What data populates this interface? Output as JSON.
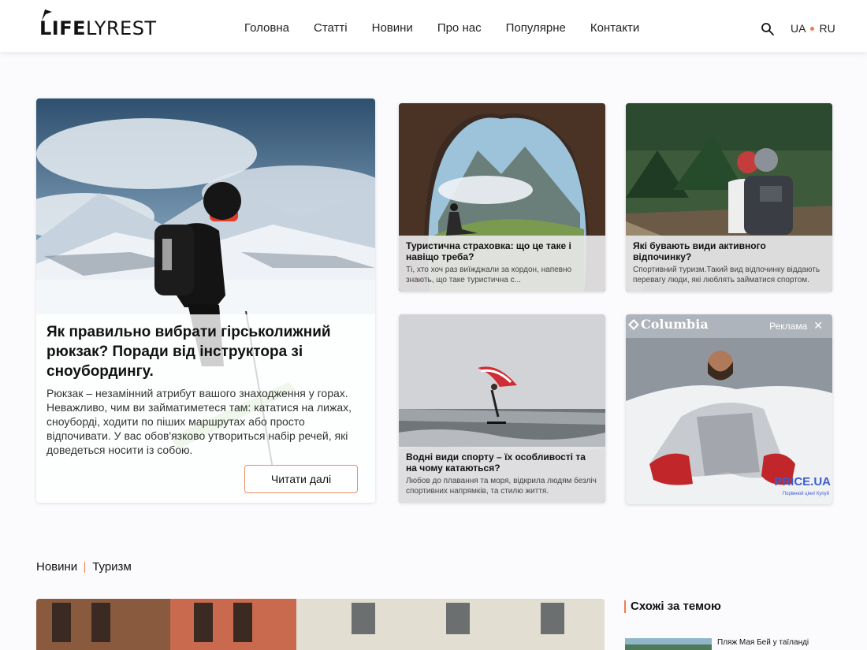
{
  "brand": {
    "logo_bold": "LIFE",
    "logo_light": "LYREST"
  },
  "nav": [
    "Головна",
    "Статті",
    "Новини",
    "Про нас",
    "Популярне",
    "Контакти"
  ],
  "lang": {
    "current": "UA",
    "other": "RU",
    "accent": "#ef7a4b"
  },
  "icons": {
    "search": "search-icon",
    "close": "close-icon"
  },
  "hero": {
    "title": "Як правильно вибрати гірськолижний рюкзак? Поради від інструктора зі сноубордингу.",
    "excerpt": "Рюкзак – незамінний атрибут вашого знаходження у горах. Неважливо, чим ви займатиметеся там: кататися на лижах, сноуборді, ходити по піших маршрутах або просто відпочивати. У вас обов'язково утвориться набір речей, які доведеться носити із собою.",
    "button": "Читати далі"
  },
  "cards": [
    {
      "title": "Туристична страховка: що це таке і навіщо треба?",
      "text": "Ті, хто хоч раз виїжджали за кордон, напевно знають, що таке туристична с..."
    },
    {
      "title": "Які бувають види активного відпочинку?",
      "text": "Спортивний туризм.Такий вид відпочинку віддають перевагу люди, які люблять займатися спортом."
    },
    {
      "title": "Водні види спорту – їх особливості та на чому катаються?",
      "text": "Любов до плавання та моря, відкрила людям безліч спортивних напрямків, та стилю життя."
    }
  ],
  "ad": {
    "brand": "Columbia",
    "label": "Реклама",
    "price_brand": "PRICE.UA",
    "price_sub": "Порівнюй ціни! Купуй"
  },
  "breadcrumb": {
    "first": "Новини",
    "second": "Туризм"
  },
  "related": {
    "title": "Схожі за темою",
    "first_item": "Пляж Мая Бей у таїланді"
  }
}
